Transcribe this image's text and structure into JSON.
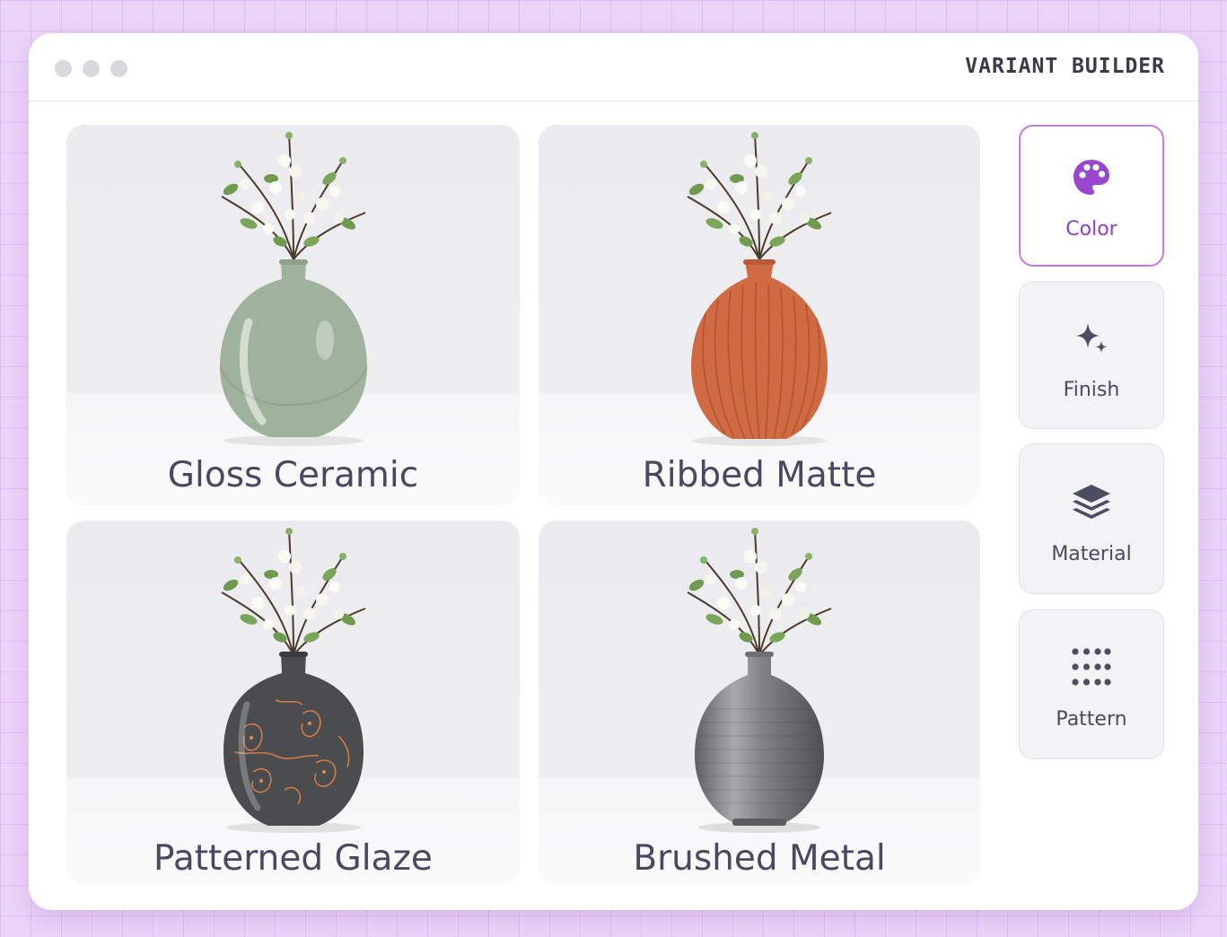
{
  "window": {
    "title": "VARIANT BUILDER"
  },
  "variants": [
    {
      "label": "Gloss Ceramic",
      "color": "#9fb29b"
    },
    {
      "label": "Ribbed Matte",
      "color": "#cf6a42"
    },
    {
      "label": "Patterned Glaze",
      "color": "#4a4c4e"
    },
    {
      "label": "Brushed Metal",
      "color": "#7f8183"
    }
  ],
  "sidebar": {
    "items": [
      {
        "label": "Color",
        "icon": "palette-icon",
        "active": true
      },
      {
        "label": "Finish",
        "icon": "sparkle-icon",
        "active": false
      },
      {
        "label": "Material",
        "icon": "layers-icon",
        "active": false
      },
      {
        "label": "Pattern",
        "icon": "dot-grid-icon",
        "active": false
      }
    ]
  },
  "colors": {
    "accent": "#8e3fc2",
    "accent_border": "#c27ce6",
    "background": "#ecd4f9"
  }
}
